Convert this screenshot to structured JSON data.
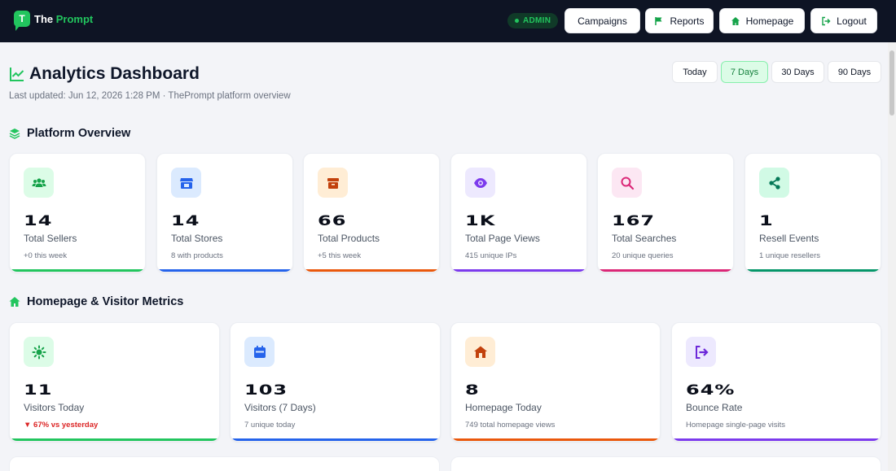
{
  "app": {
    "logo_letter": "T",
    "name_part1": "The",
    "name_part2": "Prompt"
  },
  "header": {
    "badge": "ADMIN",
    "nav": [
      {
        "label": "Campaigns",
        "icon": "none"
      },
      {
        "label": "Reports",
        "icon": "flag-icon"
      },
      {
        "label": "Homepage",
        "icon": "home-icon"
      },
      {
        "label": "Logout",
        "icon": "logout-icon"
      }
    ]
  },
  "page": {
    "title": "Analytics Dashboard",
    "last_updated": "Last updated: Jun 12, 2026 1:28 PM · ThePrompt platform overview",
    "ranges": [
      "Today",
      "7 Days",
      "30 Days",
      "90 Days"
    ],
    "active_range": "7 Days"
  },
  "platform": {
    "title": "Platform Overview",
    "cards": [
      {
        "value": "14",
        "label": "Total Sellers",
        "sub": "+0 this week",
        "icon": "users-icon",
        "color": "#22c55e"
      },
      {
        "value": "14",
        "label": "Total Stores",
        "sub": "8 with products",
        "icon": "store-icon",
        "color": "#2563eb"
      },
      {
        "value": "66",
        "label": "Total Products",
        "sub": "+5 this week",
        "icon": "box-icon",
        "color": "#ea580c"
      },
      {
        "value": "1K",
        "label": "Total Page Views",
        "sub": "415 unique IPs",
        "icon": "eye-icon",
        "color": "#7c3aed"
      },
      {
        "value": "167",
        "label": "Total Searches",
        "sub": "20 unique queries",
        "icon": "search-icon",
        "color": "#db2777"
      },
      {
        "value": "1",
        "label": "Resell Events",
        "sub": "1 unique resellers",
        "icon": "share-icon",
        "color": "#059669"
      }
    ]
  },
  "visitors": {
    "title": "Homepage & Visitor Metrics",
    "cards": [
      {
        "value": "11",
        "label": "Visitors Today",
        "sub": "▼ 67% vs yesterday",
        "icon": "sun-icon",
        "color": "#22c55e"
      },
      {
        "value": "103",
        "label": "Visitors (7 Days)",
        "sub": "7 unique today",
        "icon": "calendar-icon",
        "color": "#2563eb"
      },
      {
        "value": "8",
        "label": "Homepage Today",
        "sub": "749 total homepage views",
        "icon": "house-icon",
        "color": "#ea580c"
      },
      {
        "value": "64%",
        "label": "Bounce Rate",
        "sub": "Homepage single-page visits",
        "icon": "exit-icon",
        "color": "#7c3aed"
      }
    ]
  },
  "colors": {
    "topbar": "#0e1424",
    "brand": "#22c55e",
    "background": "#f3f4f8"
  }
}
